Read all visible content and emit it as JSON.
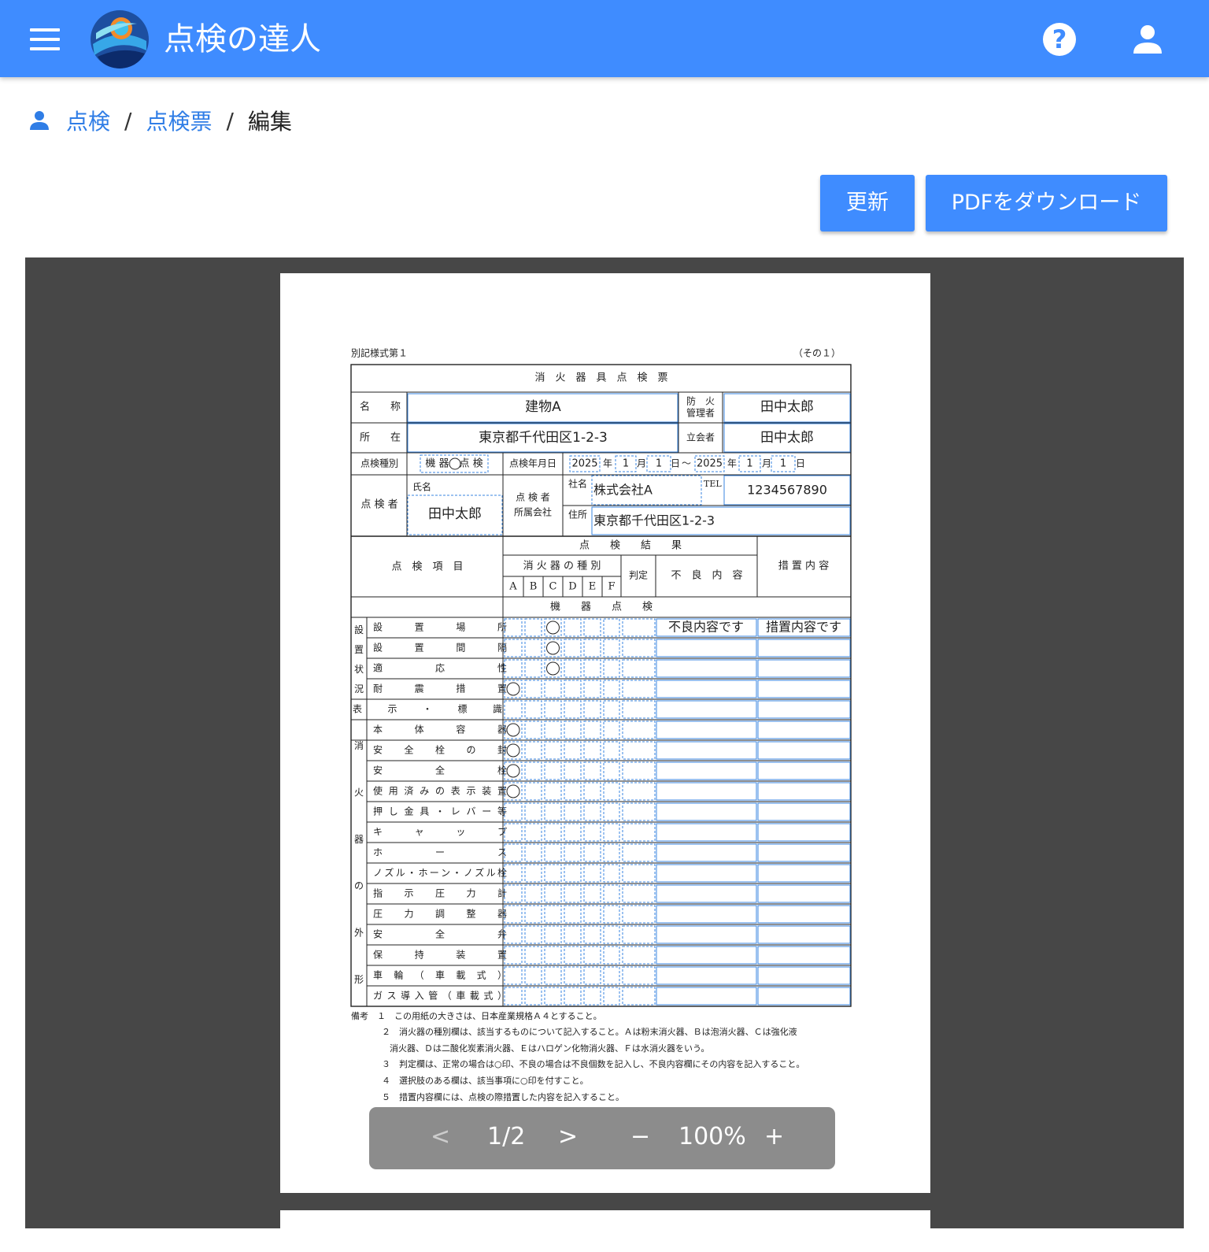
{
  "app": {
    "title": "点検の達人"
  },
  "breadcrumb": {
    "items": [
      "点検",
      "点検票"
    ],
    "current": "編集",
    "separator": "/"
  },
  "actions": {
    "update": "更新",
    "download": "PDFをダウンロード"
  },
  "viewer": {
    "page_indicator": "1/2",
    "zoom": "100%",
    "prev": "<",
    "next": ">",
    "zoom_out": "−",
    "zoom_in": "+"
  },
  "form": {
    "form_no": "別記様式第１",
    "part": "（その１）",
    "title": "消　火　器　具　点　検　票",
    "labels": {
      "name": "名　　称",
      "location": "所　　在",
      "fire_manager": "防　火 管理者",
      "witness": "立会者",
      "inspection_type": "点検種別",
      "inspection_date": "点検年月日",
      "inspector": "点 検 者",
      "inspector_name": "氏名",
      "inspector_company": "点 検 者 所属会社",
      "company_name": "社名",
      "company_address": "住所",
      "tel": "TEL",
      "year": "年",
      "month": "月",
      "day": "日",
      "tilde": "～"
    },
    "values": {
      "building_name": "建物A",
      "address": "東京都千代田区1-2-3",
      "fire_manager": "田中太郎",
      "witness": "田中太郎",
      "inspection_type": "機 器　点 検",
      "start_year": "2025",
      "start_month": "1",
      "start_day": "1",
      "end_year": "2025",
      "end_month": "1",
      "end_day": "1",
      "inspector_name": "田中太郎",
      "company_name": "株式会社A",
      "tel": "1234567890",
      "company_address": "東京都千代田区1-2-3"
    },
    "headers": {
      "item": "点　検　項　目",
      "result": "点　　検　　結　　果",
      "kind": "消 火 器 の 種 別",
      "kinds": [
        "A",
        "B",
        "C",
        "D",
        "E",
        "F"
      ],
      "judge": "判定",
      "defect": "不　良　内　容",
      "action": "措 置 内 容",
      "section": "機　　器　　点　　検"
    },
    "groups": {
      "setting": "設置状況",
      "exterior": "消火器の外形"
    },
    "rows": [
      {
        "label": "設　置　場　所",
        "marks": [
          2
        ],
        "defect": "不良内容です",
        "action": "措置内容です"
      },
      {
        "label": "設　置　間　隔",
        "marks": [
          2
        ],
        "defect": "",
        "action": ""
      },
      {
        "label": "適　　応　　性",
        "marks": [
          2
        ],
        "defect": "",
        "action": ""
      },
      {
        "label": "耐　震　措　置",
        "marks": [
          0
        ],
        "defect": "",
        "action": ""
      },
      {
        "label": "表　示　・　標　識",
        "marks": [],
        "defect": "",
        "action": ""
      },
      {
        "label": "本　体　容　器",
        "marks": [
          0
        ],
        "defect": "",
        "action": ""
      },
      {
        "label": "安 全 栓 の 封",
        "marks": [
          0
        ],
        "defect": "",
        "action": ""
      },
      {
        "label": "安　　全　　栓",
        "marks": [
          0
        ],
        "defect": "",
        "action": ""
      },
      {
        "label": "使用済みの表示装置",
        "marks": [
          0
        ],
        "defect": "",
        "action": ""
      },
      {
        "label": "押し金具・レバー等",
        "marks": [],
        "defect": "",
        "action": ""
      },
      {
        "label": "キ　ャ　ッ　プ",
        "marks": [],
        "defect": "",
        "action": ""
      },
      {
        "label": "ホ　　ー　　ス",
        "marks": [],
        "defect": "",
        "action": ""
      },
      {
        "label": "ノズル・ホーン・ノズル栓",
        "marks": [],
        "defect": "",
        "action": ""
      },
      {
        "label": "指　示　圧　力　計",
        "marks": [],
        "defect": "",
        "action": ""
      },
      {
        "label": "圧　力　調　整　器",
        "marks": [],
        "defect": "",
        "action": ""
      },
      {
        "label": "安　　全　　弁",
        "marks": [],
        "defect": "",
        "action": ""
      },
      {
        "label": "保　持　装　置",
        "marks": [],
        "defect": "",
        "action": ""
      },
      {
        "label": "車　輪（車　載　式）",
        "marks": [],
        "defect": "",
        "action": ""
      },
      {
        "label": "ガス導入管（車載式）",
        "marks": [],
        "defect": "",
        "action": ""
      }
    ],
    "mark_symbol": "○",
    "notes": [
      "備考　１　この用紙の大きさは、日本産業規格Ａ４とすること。",
      "２　消火器の種別欄は、該当するものについて記入すること。Ａは粉末消火器、Ｂは泡消火器、Ｃは強化液",
      "消火器、Ｄは二酸化炭素消火器、Ｅはハロゲン化物消火器、Ｆは水消火器をいう。",
      "３　判定欄は、正常の場合は○印、不良の場合は不良個数を記入し、不良内容欄にその内容を記入すること。",
      "４　選択肢のある欄は、該当事項に○印を付すこと。",
      "５　措置内容欄には、点検の際措置した内容を記入すること。"
    ]
  },
  "colors": {
    "brand": "#3f8cff",
    "viewer_bg": "#474747",
    "field_outline": "#3a86e0"
  }
}
